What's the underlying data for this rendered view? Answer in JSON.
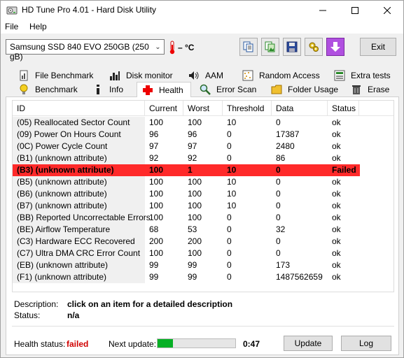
{
  "window": {
    "title": "HD Tune Pro 4.01 - Hard Disk Utility"
  },
  "menu": {
    "file": "File",
    "help": "Help"
  },
  "toolbar": {
    "drive": "Samsung SSD 840 EVO 250GB (250 gB)",
    "temperature": "– °C",
    "exit": "Exit"
  },
  "tabs": {
    "row1": [
      "File Benchmark",
      "Disk monitor",
      "AAM",
      "Random Access",
      "Extra tests"
    ],
    "row2": [
      "Benchmark",
      "Info",
      "Health",
      "Error Scan",
      "Folder Usage",
      "Erase"
    ],
    "active": "Health"
  },
  "table": {
    "headers": [
      "ID",
      "Current",
      "Worst",
      "Threshold",
      "Data",
      "Status"
    ],
    "rows": [
      [
        "(05) Reallocated Sector Count",
        "100",
        "100",
        "10",
        "0",
        "ok"
      ],
      [
        "(09) Power On Hours Count",
        "96",
        "96",
        "0",
        "17387",
        "ok"
      ],
      [
        "(0C) Power Cycle Count",
        "97",
        "97",
        "0",
        "2480",
        "ok"
      ],
      [
        "(B1) (unknown attribute)",
        "92",
        "92",
        "0",
        "86",
        "ok"
      ],
      [
        "(B3) (unknown attribute)",
        "100",
        "1",
        "10",
        "0",
        "Failed"
      ],
      [
        "(B5) (unknown attribute)",
        "100",
        "100",
        "10",
        "0",
        "ok"
      ],
      [
        "(B6) (unknown attribute)",
        "100",
        "100",
        "10",
        "0",
        "ok"
      ],
      [
        "(B7) (unknown attribute)",
        "100",
        "100",
        "10",
        "0",
        "ok"
      ],
      [
        "(BB) Reported Uncorrectable Errors",
        "100",
        "100",
        "0",
        "0",
        "ok"
      ],
      [
        "(BE) Airflow Temperature",
        "68",
        "53",
        "0",
        "32",
        "ok"
      ],
      [
        "(C3) Hardware ECC Recovered",
        "200",
        "200",
        "0",
        "0",
        "ok"
      ],
      [
        "(C7) Ultra DMA CRC Error Count",
        "100",
        "100",
        "0",
        "0",
        "ok"
      ],
      [
        "(EB) (unknown attribute)",
        "99",
        "99",
        "0",
        "173",
        "ok"
      ],
      [
        "(F1) (unknown attribute)",
        "99",
        "99",
        "0",
        "1487562659",
        "ok"
      ]
    ],
    "failed_row_color": "#ff2a2a"
  },
  "details": {
    "description_label": "Description:",
    "description_value": "click on an item for a detailed description",
    "status_label": "Status:",
    "status_value": "n/a"
  },
  "footer": {
    "health_label": "Health status:",
    "health_value": "failed",
    "health_color": "#d00000",
    "next_update_label": "Next update:",
    "progress_fraction": 0.2,
    "countdown": "0:47",
    "update_button": "Update",
    "log_button": "Log"
  }
}
